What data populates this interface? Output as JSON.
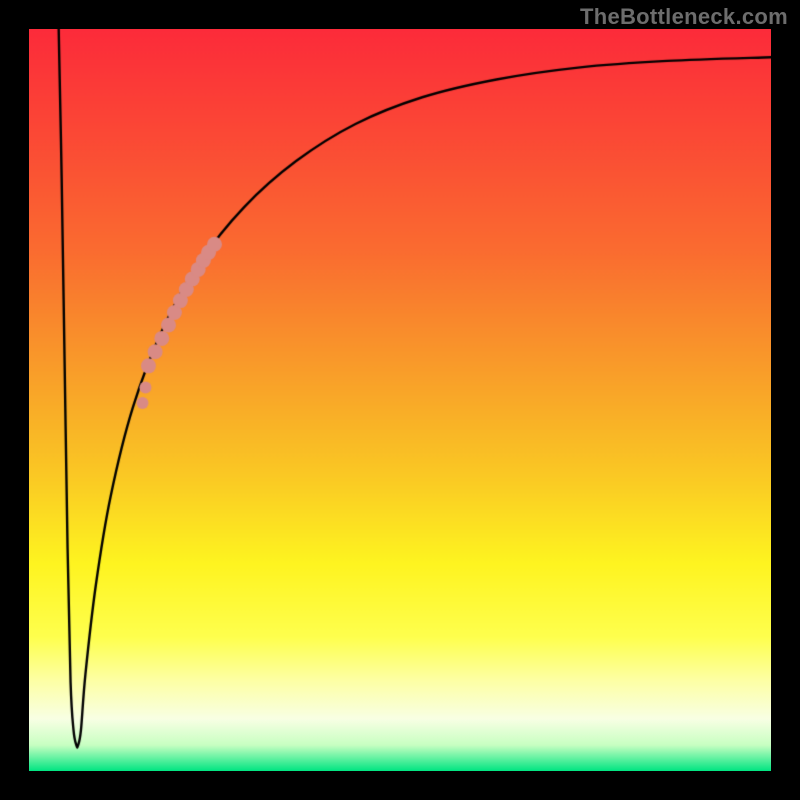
{
  "watermark": "TheBottleneck.com",
  "colors": {
    "frame": "#000000",
    "curve": "#000000",
    "marker": "#d98a85",
    "gradient_stops": [
      {
        "y": 0.0,
        "color": "#fc2b3a"
      },
      {
        "y": 0.15,
        "color": "#fb4a35"
      },
      {
        "y": 0.3,
        "color": "#fa6c30"
      },
      {
        "y": 0.45,
        "color": "#f99a2a"
      },
      {
        "y": 0.6,
        "color": "#fac824"
      },
      {
        "y": 0.72,
        "color": "#fef420"
      },
      {
        "y": 0.82,
        "color": "#feff4e"
      },
      {
        "y": 0.88,
        "color": "#fdffa7"
      },
      {
        "y": 0.93,
        "color": "#f8ffe4"
      },
      {
        "y": 0.965,
        "color": "#c8ffc2"
      },
      {
        "y": 1.0,
        "color": "#00e582"
      }
    ]
  },
  "chart_data": {
    "type": "line",
    "title": "",
    "xlabel": "",
    "ylabel": "",
    "xlim": [
      0,
      100
    ],
    "ylim": [
      0,
      100
    ],
    "curve": {
      "comment": "x in 0..100, y in 0..100, (0,0) is top-left of plot area",
      "points": [
        [
          4.0,
          0.0
        ],
        [
          4.4,
          20.0
        ],
        [
          4.8,
          45.0
        ],
        [
          5.2,
          70.0
        ],
        [
          5.6,
          88.0
        ],
        [
          6.0,
          94.5
        ],
        [
          6.4,
          96.6
        ],
        [
          6.6,
          96.6
        ],
        [
          7.0,
          94.5
        ],
        [
          7.6,
          87.0
        ],
        [
          9.0,
          75.0
        ],
        [
          11.0,
          63.0
        ],
        [
          14.0,
          51.0
        ],
        [
          18.0,
          40.5
        ],
        [
          23.0,
          31.5
        ],
        [
          29.0,
          24.0
        ],
        [
          36.0,
          17.8
        ],
        [
          44.0,
          12.8
        ],
        [
          53.0,
          9.2
        ],
        [
          63.0,
          6.8
        ],
        [
          74.0,
          5.2
        ],
        [
          86.0,
          4.3
        ],
        [
          100.0,
          3.8
        ]
      ]
    },
    "markers": {
      "comment": "highlighted segment on the rising right-hand branch",
      "points": [
        [
          16.1,
          45.4
        ],
        [
          17.0,
          43.5
        ],
        [
          17.9,
          41.7
        ],
        [
          18.8,
          39.9
        ],
        [
          19.6,
          38.2
        ],
        [
          20.4,
          36.6
        ],
        [
          21.2,
          35.1
        ],
        [
          22.0,
          33.7
        ],
        [
          22.8,
          32.4
        ],
        [
          23.5,
          31.2
        ],
        [
          24.2,
          30.1
        ],
        [
          25.0,
          29.0
        ]
      ],
      "extra_points": [
        [
          15.7,
          48.3
        ],
        [
          15.3,
          50.4
        ]
      ],
      "radius_main": 7.5,
      "radius_extra": 6.0
    }
  }
}
